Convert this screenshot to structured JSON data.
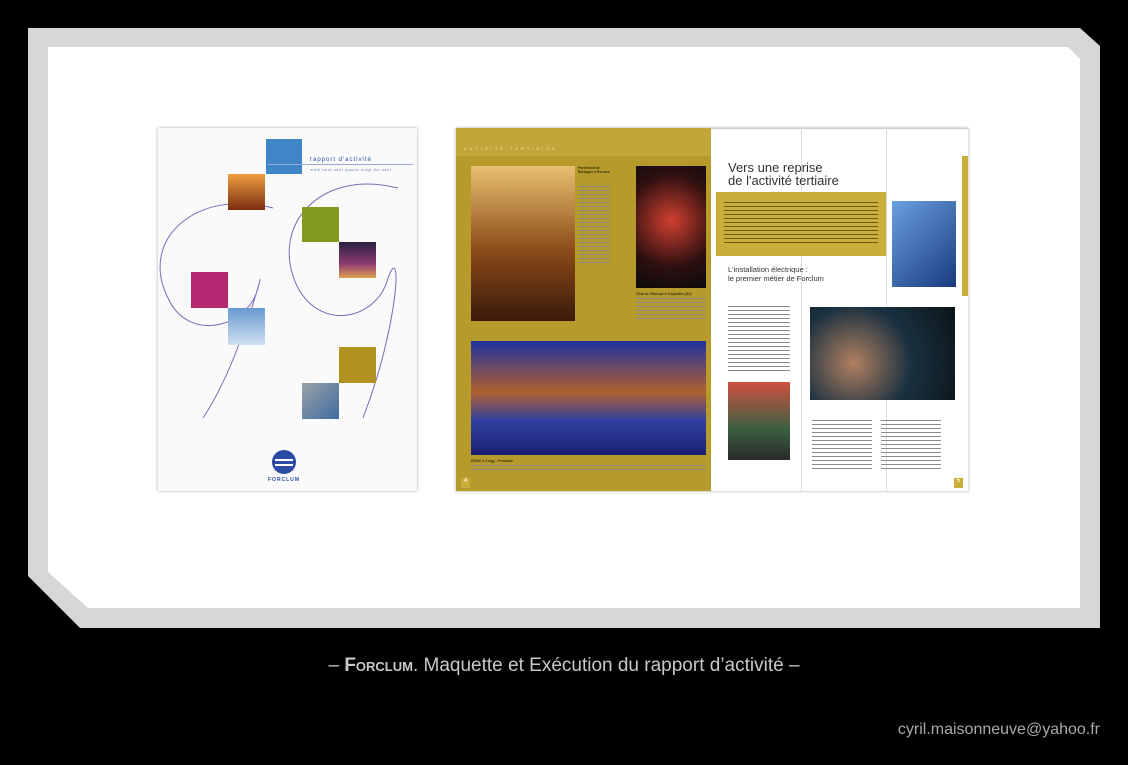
{
  "cover": {
    "title": "rapport d'activité",
    "subtitle": "mille neuf cent quatre vingt dix neuf",
    "logo_text": "FORCLUM",
    "square_colors": [
      "#3f86c8",
      "#7f9a1f",
      "#b3286f",
      "#b19220"
    ]
  },
  "spread": {
    "section_band": "ACTIVITÉ TERTIAIRE",
    "heading_line1": "Vers une reprise",
    "heading_line2": "de l'activité tertiaire",
    "subheading_line1": "L'installation électrique :",
    "subheading_line2": "le premier métier de Forclum",
    "captions": {
      "parlement": "Parlement de Bretagne à Rennes",
      "club": "Club de l'Europe à Coquelles (62)",
      "edmc": "EDMC à Cergy - Pontoise"
    },
    "page_left": "4",
    "page_right": "5"
  },
  "footer": {
    "caption_prefix": "– ",
    "caption_brand": "Forclum",
    "caption_text": ". Maquette et Exécution du rapport d’activité –",
    "email": "cyril.maisonneuve@yahoo.fr"
  }
}
